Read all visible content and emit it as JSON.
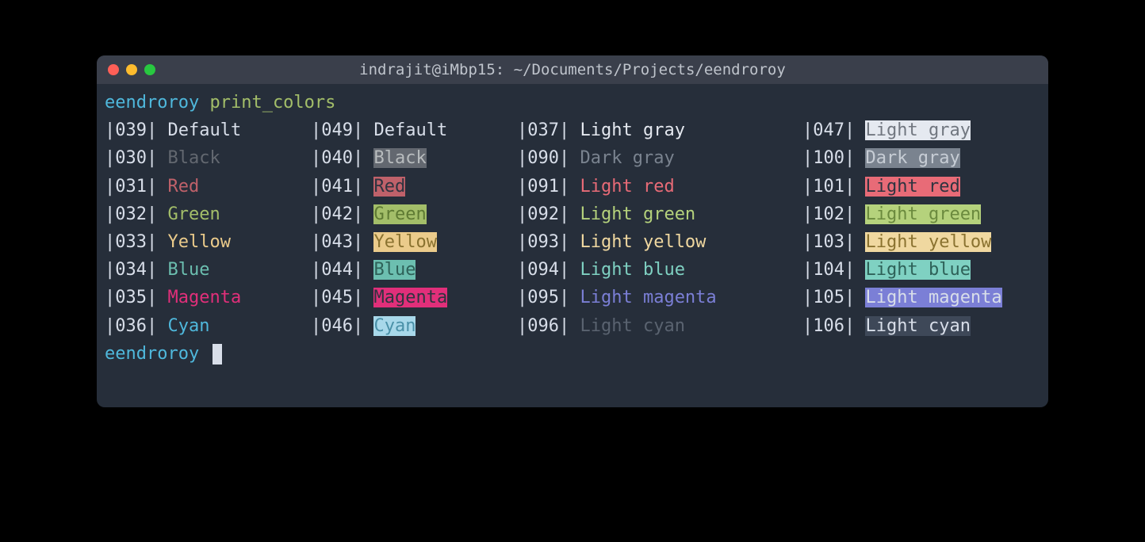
{
  "window": {
    "title": "indrajit@iMbp15: ~/Documents/Projects/eendroroy"
  },
  "prompt": {
    "user": "eendroroy",
    "command": "print_colors"
  },
  "rows": [
    {
      "c1": {
        "code": "039",
        "label": "Default",
        "fg": "#D8DEE9",
        "bg": null
      },
      "c2": {
        "code": "049",
        "label": "Default",
        "fg": "#D8DEE9",
        "bg": null
      },
      "c3": {
        "code": "037",
        "label": "Light gray",
        "fg": "#E5E9F0",
        "bg": null
      },
      "c4": {
        "code": "047",
        "label": "Light gray",
        "fg": "#717780",
        "bg": "#E5E9F0"
      }
    },
    {
      "c1": {
        "code": "030",
        "label": "Black",
        "fg": "#636870",
        "bg": null
      },
      "c2": {
        "code": "040",
        "label": "Black",
        "fg": "#B8BCBE",
        "bg": "#636870"
      },
      "c3": {
        "code": "090",
        "label": "Dark gray",
        "fg": "#7A838F",
        "bg": null
      },
      "c4": {
        "code": "100",
        "label": "Dark gray",
        "fg": "#C7CDD5",
        "bg": "#7A838F"
      }
    },
    {
      "c1": {
        "code": "031",
        "label": "Red",
        "fg": "#BF616A",
        "bg": null
      },
      "c2": {
        "code": "041",
        "label": "Red",
        "fg": "#2E3440",
        "bg": "#BF616A"
      },
      "c3": {
        "code": "091",
        "label": "Light red",
        "fg": "#E86B77",
        "bg": null
      },
      "c4": {
        "code": "101",
        "label": "Light red",
        "fg": "#2E3440",
        "bg": "#E86B77"
      }
    },
    {
      "c1": {
        "code": "032",
        "label": "Green",
        "fg": "#A3BE69",
        "bg": null
      },
      "c2": {
        "code": "042",
        "label": "Green",
        "fg": "#5E7A33",
        "bg": "#A3BE69"
      },
      "c3": {
        "code": "092",
        "label": "Light green",
        "fg": "#B5D27C",
        "bg": null
      },
      "c4": {
        "code": "102",
        "label": "Light green",
        "fg": "#6B8A3E",
        "bg": "#B5D27C"
      }
    },
    {
      "c1": {
        "code": "033",
        "label": "Yellow",
        "fg": "#EBCB8B",
        "bg": null
      },
      "c2": {
        "code": "043",
        "label": "Yellow",
        "fg": "#8A7230",
        "bg": "#EBCB8B"
      },
      "c3": {
        "code": "093",
        "label": "Light yellow",
        "fg": "#F0D8A0",
        "bg": null
      },
      "c4": {
        "code": "103",
        "label": "Light yellow",
        "fg": "#8A7230",
        "bg": "#F0D8A0"
      }
    },
    {
      "c1": {
        "code": "034",
        "label": "Blue",
        "fg": "#6CBFB0",
        "bg": null
      },
      "c2": {
        "code": "044",
        "label": "Blue",
        "fg": "#2E6158",
        "bg": "#6CBFB0"
      },
      "c3": {
        "code": "094",
        "label": "Light blue",
        "fg": "#7FD1C2",
        "bg": null
      },
      "c4": {
        "code": "104",
        "label": "Light blue",
        "fg": "#2E6158",
        "bg": "#7FD1C2"
      }
    },
    {
      "c1": {
        "code": "035",
        "label": "Magenta",
        "fg": "#E12F7A",
        "bg": null
      },
      "c2": {
        "code": "045",
        "label": "Magenta",
        "fg": "#2E3440",
        "bg": "#E12F7A"
      },
      "c3": {
        "code": "095",
        "label": "Light magenta",
        "fg": "#7B7FD6",
        "bg": null
      },
      "c4": {
        "code": "105",
        "label": "Light magenta",
        "fg": "#D8DEE9",
        "bg": "#7B7FD6"
      }
    },
    {
      "c1": {
        "code": "036",
        "label": "Cyan",
        "fg": "#4FB8DC",
        "bg": null
      },
      "c2": {
        "code": "046",
        "label": "Cyan",
        "fg": "#4A90A8",
        "bg": "#A8D8EA"
      },
      "c3": {
        "code": "096",
        "label": "Light cyan",
        "fg": "#5A6370",
        "bg": null
      },
      "c4": {
        "code": "106",
        "label": "Light cyan",
        "fg": "#D8DEE9",
        "bg": "#3E4858"
      }
    }
  ]
}
